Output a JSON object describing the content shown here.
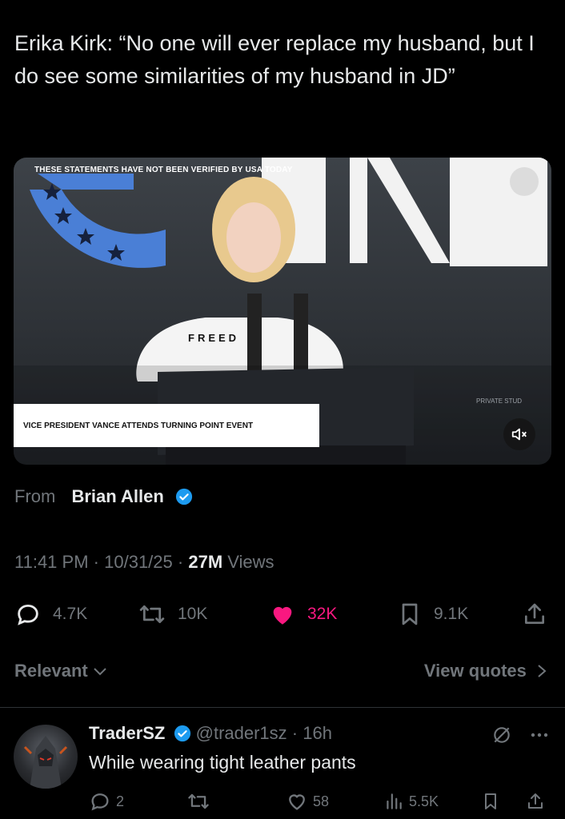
{
  "post": {
    "text": "Erika Kirk: “No one will ever replace my husband, but I do see some similarities of my husband in JD”"
  },
  "video": {
    "top_banner": "THESE STATEMENTS HAVE NOT BEEN VERIFIED BY USA TODAY",
    "caption": "VICE PRESIDENT VANCE ATTENDS TURNING POINT EVENT",
    "shirt_text": "FREED",
    "backdrop_text": "PRIVATE STUD",
    "mute_icon": "speaker-muted-icon"
  },
  "source": {
    "from_label": "From",
    "name": "Brian Allen"
  },
  "meta": {
    "time": "11:41 PM",
    "date": "10/31/25",
    "views_count": "27M",
    "views_label": "Views"
  },
  "actions": {
    "replies": "4.7K",
    "reposts": "10K",
    "likes": "32K",
    "bookmarks": "9.1K"
  },
  "filters": {
    "relevant": "Relevant",
    "view_quotes": "View quotes"
  },
  "reply": {
    "name": "TraderSZ",
    "handle": "@trader1sz",
    "time": "16h",
    "text": "While wearing tight leather pants",
    "replies": "2",
    "reposts": "",
    "likes": "58",
    "views": "5.5K"
  },
  "colors": {
    "background": "#000000",
    "text": "#e7e9ea",
    "muted": "#71767b",
    "like": "#f91880",
    "verified": "#1d9bf0"
  }
}
